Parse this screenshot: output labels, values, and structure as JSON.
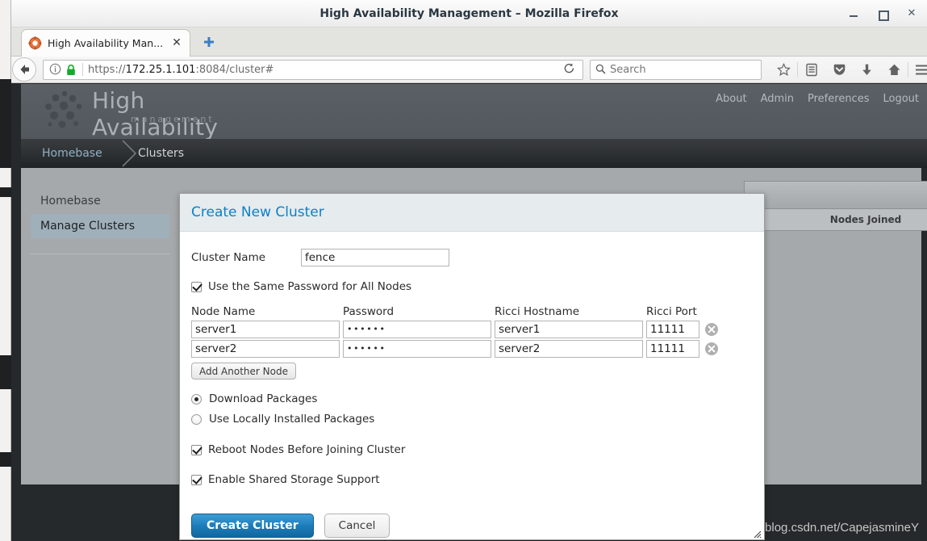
{
  "window": {
    "title": "High Availability Management – Mozilla Firefox",
    "minimize_label": "_",
    "maximize_label": "□",
    "close_label": "✕"
  },
  "browser": {
    "tab": {
      "title": "High Availability Man...",
      "close_label": "✕",
      "favicon": "firefox-page-icon"
    },
    "new_tab_label": "+",
    "back_label": "back-arrow",
    "url_prefix": "https://",
    "url_host": "172.25.1.101",
    "url_suffix": ":8084/cluster#",
    "url_full": "https://172.25.1.101:8084/cluster#",
    "reload_label": "⟳",
    "search_placeholder": "Search",
    "toolbar_icons": [
      "bookmark-star-icon",
      "library-icon",
      "pocket-icon",
      "downloads-icon",
      "home-icon",
      "menu-icon"
    ]
  },
  "app": {
    "logo_title": "High Availability",
    "logo_subtitle": "management",
    "topnav": [
      "About",
      "Admin",
      "Preferences",
      "Logout"
    ],
    "breadcrumb": [
      "Homebase",
      "Clusters"
    ],
    "sidebar": [
      {
        "label": "Homebase",
        "active": false
      },
      {
        "label": "Manage Clusters",
        "active": true
      }
    ],
    "table": {
      "columns": [
        "Nodes Joined"
      ]
    },
    "watermark": "https://blog.csdn.net/CapejasmineY"
  },
  "dialog": {
    "title": "Create New Cluster",
    "cluster_name_label": "Cluster Name",
    "cluster_name_value": "fence",
    "same_password_label": "Use the Same Password for All Nodes",
    "same_password_checked": true,
    "node_columns": [
      "Node Name",
      "Password",
      "Ricci Hostname",
      "Ricci Port"
    ],
    "nodes": [
      {
        "name": "server1",
        "password": "••••••",
        "hostname": "server1",
        "port": "11111",
        "delete_label": "✕"
      },
      {
        "name": "server2",
        "password": "••••••",
        "hostname": "server2",
        "port": "11111",
        "delete_label": "✕"
      }
    ],
    "add_node_label": "Add Another Node",
    "package_options": [
      {
        "label": "Download Packages",
        "selected": true
      },
      {
        "label": "Use Locally Installed Packages",
        "selected": false
      }
    ],
    "reboot_label": "Reboot Nodes Before Joining Cluster",
    "reboot_checked": true,
    "shared_storage_label": "Enable Shared Storage Support",
    "shared_storage_checked": true,
    "submit_label": "Create Cluster",
    "cancel_label": "Cancel"
  },
  "colors": {
    "accent_blue": "#0b82c8",
    "primary_button": "#1b7cba",
    "header_gray": "#565c61",
    "content_gray": "#a6a9ab",
    "sidebar_active": "#a0b0ba"
  }
}
